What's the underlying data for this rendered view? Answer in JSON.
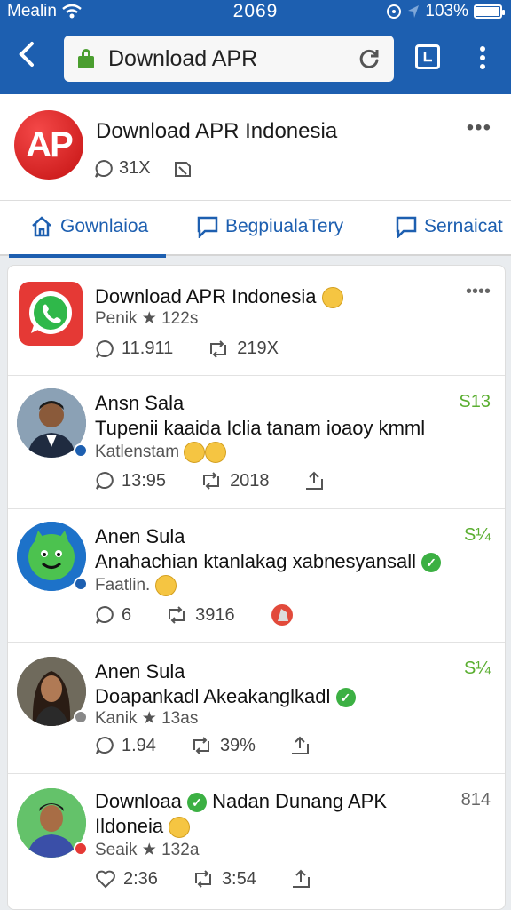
{
  "status_bar": {
    "carrier": "Mealin",
    "time": "2069",
    "battery": "103%",
    "battery_level": 0.95
  },
  "browser": {
    "url_text": "Download APR",
    "colors": {
      "toolbar": "#1d5fb0",
      "lock": "#4a9e2f"
    }
  },
  "page_header": {
    "logo_text": "AP",
    "title": "Download APR Indonesia",
    "comments": "31X",
    "more": "•••"
  },
  "tabs": [
    {
      "label": "Gownlaioa",
      "active": true
    },
    {
      "label": "BegpiualaTery",
      "active": false
    },
    {
      "label": "Sernaicat",
      "active": false
    }
  ],
  "posts": [
    {
      "name": "Download APR Indonesia",
      "sub": "Penik ★ 122s",
      "corner": "••••",
      "comments": "11.911",
      "reposts": "219X",
      "avatar": "whatsapp-logo"
    },
    {
      "name": "Ansn Sala",
      "text": "Tupenii kaaida Iclia tanam ioaoy kmml",
      "sub": "Katlenstam",
      "corner": "S13",
      "comments": "13:95",
      "reposts": "2018",
      "avatar": "man-photo"
    },
    {
      "name": "Anen Sula",
      "text": "Anahachian ktanlakag xabnesyansall",
      "sub": "Faatlin.",
      "corner": "S¼",
      "comments": "6",
      "reposts": "3916",
      "avatar": "green-mascot"
    },
    {
      "name": "Anen Sula",
      "text": "Doapankadl Akeakanglkadl",
      "sub": "Kanik ★ 13as",
      "corner": "S¼",
      "comments": "1.94",
      "reposts": "39%",
      "avatar": "woman-photo"
    },
    {
      "name": "Downloaa",
      "name_rest": "Nadan Dunang APK",
      "text": "Ildoneia",
      "sub": "Seaik ★ 132a",
      "corner": "814",
      "comments": "2:36",
      "reposts": "3:54",
      "avatar": "man-photo-2"
    }
  ]
}
